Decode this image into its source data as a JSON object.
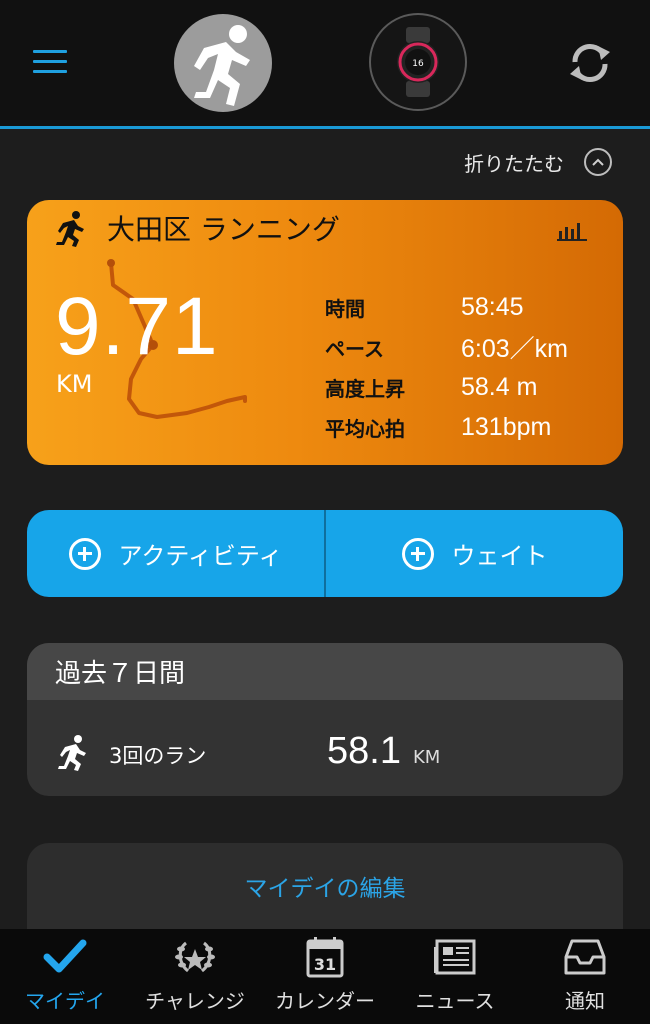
{
  "header": {
    "menu_icon": "hamburger-menu-icon",
    "avatar_icon": "running-person-icon",
    "device_icon": "watch-icon",
    "device_watch_number": "16",
    "sync_icon": "sync-icon"
  },
  "collapse": {
    "label": "折りたたむ",
    "icon": "chevron-up-icon"
  },
  "activity": {
    "title": "大田区 ランニング",
    "distance": "9.71",
    "unit": "KM",
    "stats": [
      {
        "label": "時間",
        "value": "58:45"
      },
      {
        "label": "ペース",
        "value": "6:03／km"
      },
      {
        "label": "高度上昇",
        "value": "58.4 m"
      },
      {
        "label": "平均心拍",
        "value": "131bpm"
      }
    ],
    "colors": {
      "start": "#f7a11a",
      "end": "#d46a04",
      "route": "#c2570a"
    }
  },
  "actions": [
    {
      "label": "アクティビティ",
      "icon": "plus-circle-icon"
    },
    {
      "label": "ウェイト",
      "icon": "plus-circle-icon"
    }
  ],
  "week": {
    "title": "過去７日間",
    "label": "3回のラン",
    "value": "58.1",
    "unit": "KM"
  },
  "edit": {
    "label": "マイデイの編集"
  },
  "nav": [
    {
      "label": "マイデイ",
      "icon": "checkmark-icon",
      "active": true
    },
    {
      "label": "チャレンジ",
      "icon": "laurel-icon",
      "active": false
    },
    {
      "label": "カレンダー",
      "icon": "calendar-icon",
      "active": false,
      "icon_text": "31"
    },
    {
      "label": "ニュース",
      "icon": "newspaper-icon",
      "active": false
    },
    {
      "label": "通知",
      "icon": "inbox-icon",
      "active": false
    }
  ],
  "accent_color": "#1fa0e0"
}
